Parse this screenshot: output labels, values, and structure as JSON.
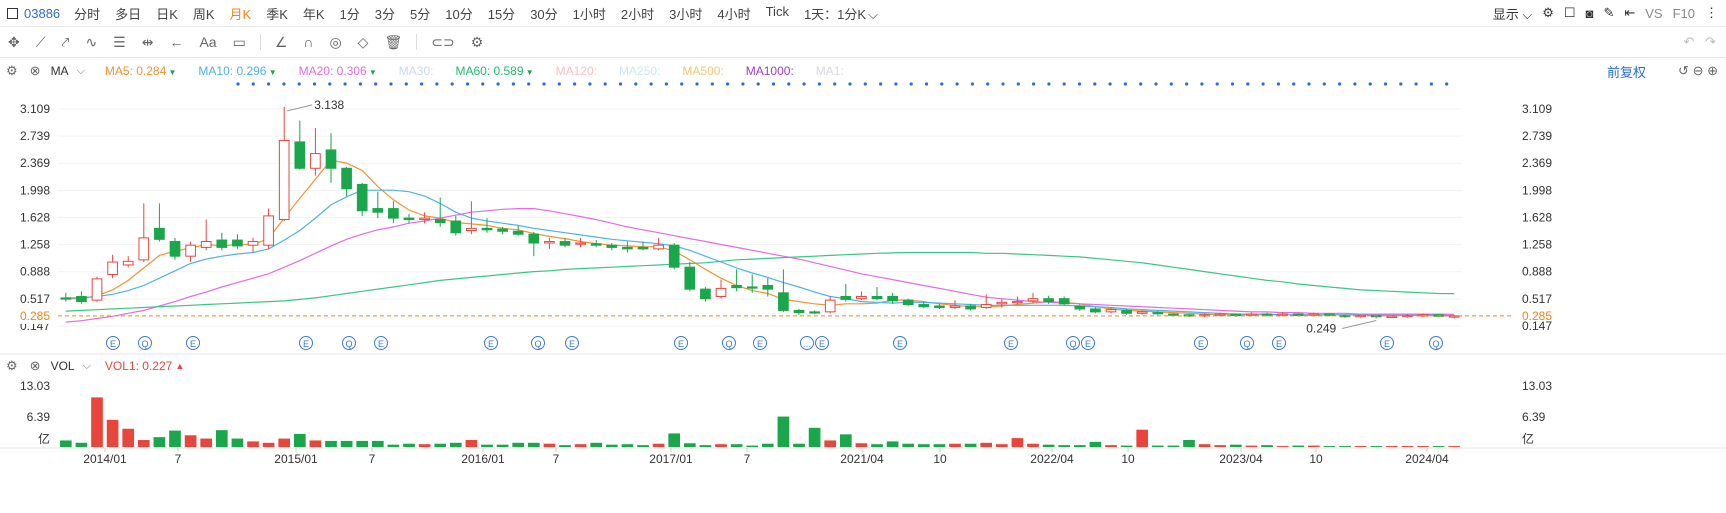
{
  "top": {
    "code": "03886",
    "periods": [
      "分时",
      "多日",
      "日K",
      "周K",
      "月K",
      "季K",
      "年K",
      "1分",
      "3分",
      "5分",
      "10分",
      "15分",
      "30分",
      "1小时",
      "2小时",
      "3小时",
      "4小时",
      "Tick"
    ],
    "active_period": "月K",
    "interval_select": "1天：1分K",
    "display": "显示",
    "vs_label": "VS",
    "f10_label": "F10"
  },
  "toolbar": {
    "text_tool": "Aa"
  },
  "indicator": {
    "name": "MA",
    "ma": [
      {
        "label": "MA5: 0.284",
        "color": "#f29335",
        "arrow": "down"
      },
      {
        "label": "MA10: 0.296",
        "color": "#4fb2e8",
        "arrow": "down"
      },
      {
        "label": "MA20: 0.306",
        "color": "#e26de0",
        "arrow": "down"
      },
      {
        "label": "MA30:",
        "color": "#c8daf0"
      },
      {
        "label": "MA60: 0.589",
        "color": "#26b774",
        "arrow": "down"
      },
      {
        "label": "MA120:",
        "color": "#f4c3c3"
      },
      {
        "label": "MA250:",
        "color": "#c9e8f3"
      },
      {
        "label": "MA500:",
        "color": "#f3c577"
      },
      {
        "label": "MA1000:",
        "color": "#9a41c9"
      },
      {
        "label": "MA1:",
        "color": "#d8d8e0"
      }
    ],
    "adjust": "前复权"
  },
  "vol_indicator": {
    "name": "VOL",
    "vol1": "VOL1: 0.227"
  },
  "colors": {
    "up": "#e8463d",
    "down": "#1aa64a",
    "accent": "#2b6cd6",
    "last_price": "#f0861a"
  },
  "chart_data": {
    "type": "candlestick",
    "price_ticks": [
      "3.109",
      "2.739",
      "2.369",
      "1.998",
      "1.628",
      "1.258",
      "0.888",
      "0.517",
      "0.147"
    ],
    "last_price": "0.285",
    "high_label": "3.138",
    "low_label": "0.249",
    "ylim": [
      0.147,
      3.138
    ],
    "x_ticks": [
      "2014/01",
      "7",
      "2015/01",
      "7",
      "2016/01",
      "7",
      "2017/01",
      "7",
      "2021/04",
      "10",
      "2022/04",
      "10",
      "2023/04",
      "10",
      "2024/04"
    ],
    "vol_ticks": [
      "13.03",
      "6.39",
      "亿"
    ],
    "candles": [
      [
        0.53,
        0.52,
        0.6,
        0.48
      ],
      [
        0.55,
        0.48,
        0.62,
        0.45
      ],
      [
        0.5,
        0.79,
        0.82,
        0.48
      ],
      [
        0.85,
        1.02,
        1.12,
        0.8
      ],
      [
        0.98,
        1.03,
        1.1,
        0.95
      ],
      [
        1.05,
        1.35,
        1.82,
        1.02
      ],
      [
        1.48,
        1.33,
        1.82,
        1.3
      ],
      [
        1.3,
        1.1,
        1.35,
        1.05
      ],
      [
        1.1,
        1.25,
        1.3,
        1.02
      ],
      [
        1.22,
        1.3,
        1.6,
        1.18
      ],
      [
        1.32,
        1.22,
        1.42,
        1.18
      ],
      [
        1.32,
        1.24,
        1.4,
        1.2
      ],
      [
        1.25,
        1.3,
        1.35,
        1.15
      ],
      [
        1.25,
        1.65,
        1.75,
        1.2
      ],
      [
        1.6,
        2.68,
        3.138,
        1.58
      ],
      [
        2.66,
        2.3,
        2.95,
        2.28
      ],
      [
        2.3,
        2.5,
        2.85,
        2.2
      ],
      [
        2.55,
        2.3,
        2.78,
        2.1
      ],
      [
        2.3,
        2.02,
        2.32,
        1.92
      ],
      [
        2.08,
        1.72,
        2.1,
        1.65
      ],
      [
        1.75,
        1.7,
        1.98,
        1.62
      ],
      [
        1.75,
        1.62,
        1.85,
        1.55
      ],
      [
        1.62,
        1.6,
        1.68,
        1.55
      ],
      [
        1.6,
        1.62,
        1.7,
        1.55
      ],
      [
        1.6,
        1.56,
        1.9,
        1.5
      ],
      [
        1.58,
        1.42,
        1.65,
        1.38
      ],
      [
        1.45,
        1.48,
        1.85,
        1.4
      ],
      [
        1.48,
        1.46,
        1.62,
        1.42
      ],
      [
        1.47,
        1.44,
        1.5,
        1.4
      ],
      [
        1.44,
        1.4,
        1.52,
        1.38
      ],
      [
        1.4,
        1.28,
        1.43,
        1.1
      ],
      [
        1.28,
        1.3,
        1.35,
        1.2
      ],
      [
        1.3,
        1.25,
        1.35,
        1.22
      ],
      [
        1.27,
        1.28,
        1.35,
        1.22
      ],
      [
        1.27,
        1.25,
        1.32,
        1.22
      ],
      [
        1.25,
        1.22,
        1.28,
        1.18
      ],
      [
        1.22,
        1.2,
        1.3,
        1.15
      ],
      [
        1.22,
        1.2,
        1.3,
        1.18
      ],
      [
        1.2,
        1.25,
        1.35,
        1.18
      ],
      [
        1.25,
        0.95,
        1.28,
        0.92
      ],
      [
        0.95,
        0.65,
        1.02,
        0.62
      ],
      [
        0.65,
        0.52,
        0.68,
        0.48
      ],
      [
        0.55,
        0.66,
        0.78,
        0.52
      ],
      [
        0.7,
        0.67,
        0.92,
        0.62
      ],
      [
        0.68,
        0.67,
        0.85,
        0.6
      ],
      [
        0.7,
        0.65,
        0.8,
        0.55
      ],
      [
        0.6,
        0.36,
        0.92,
        0.34
      ],
      [
        0.36,
        0.33,
        0.38,
        0.3
      ],
      [
        0.34,
        0.33,
        0.36,
        0.31
      ],
      [
        0.34,
        0.5,
        0.55,
        0.32
      ],
      [
        0.55,
        0.51,
        0.72,
        0.48
      ],
      [
        0.52,
        0.55,
        0.62,
        0.5
      ],
      [
        0.55,
        0.52,
        0.68,
        0.5
      ],
      [
        0.55,
        0.49,
        0.6,
        0.45
      ],
      [
        0.5,
        0.44,
        0.52,
        0.42
      ],
      [
        0.44,
        0.41,
        0.48,
        0.39
      ],
      [
        0.42,
        0.4,
        0.45,
        0.38
      ],
      [
        0.4,
        0.42,
        0.5,
        0.38
      ],
      [
        0.42,
        0.38,
        0.45,
        0.36
      ],
      [
        0.4,
        0.44,
        0.58,
        0.38
      ],
      [
        0.45,
        0.47,
        0.52,
        0.4
      ],
      [
        0.47,
        0.48,
        0.55,
        0.44
      ],
      [
        0.49,
        0.52,
        0.6,
        0.46
      ],
      [
        0.52,
        0.48,
        0.56,
        0.45
      ],
      [
        0.52,
        0.45,
        0.55,
        0.43
      ],
      [
        0.42,
        0.38,
        0.44,
        0.35
      ],
      [
        0.38,
        0.34,
        0.4,
        0.32
      ],
      [
        0.34,
        0.37,
        0.4,
        0.32
      ],
      [
        0.36,
        0.32,
        0.38,
        0.3
      ],
      [
        0.32,
        0.34,
        0.36,
        0.3
      ],
      [
        0.33,
        0.32,
        0.35,
        0.3
      ],
      [
        0.31,
        0.3,
        0.32,
        0.28
      ],
      [
        0.3,
        0.29,
        0.31,
        0.27
      ],
      [
        0.29,
        0.3,
        0.32,
        0.27
      ],
      [
        0.3,
        0.31,
        0.33,
        0.28
      ],
      [
        0.31,
        0.29,
        0.32,
        0.27
      ],
      [
        0.3,
        0.31,
        0.33,
        0.28
      ],
      [
        0.31,
        0.3,
        0.33,
        0.28
      ],
      [
        0.3,
        0.31,
        0.34,
        0.28
      ],
      [
        0.31,
        0.29,
        0.32,
        0.28
      ],
      [
        0.3,
        0.31,
        0.33,
        0.28
      ],
      [
        0.31,
        0.3,
        0.32,
        0.28
      ],
      [
        0.29,
        0.28,
        0.3,
        0.26
      ],
      [
        0.28,
        0.29,
        0.3,
        0.26
      ],
      [
        0.29,
        0.28,
        0.29,
        0.25
      ],
      [
        0.28,
        0.28,
        0.29,
        0.26
      ],
      [
        0.28,
        0.29,
        0.31,
        0.26
      ],
      [
        0.29,
        0.3,
        0.32,
        0.27
      ],
      [
        0.3,
        0.28,
        0.31,
        0.27
      ],
      [
        0.28,
        0.285,
        0.3,
        0.25
      ]
    ],
    "volumes": [
      1.4,
      0.9,
      10.6,
      5.8,
      3.9,
      1.5,
      2.1,
      3.5,
      2.5,
      1.8,
      3.6,
      1.8,
      1.2,
      0.9,
      1.8,
      2.8,
      1.4,
      1.3,
      1.3,
      1.3,
      1.3,
      0.5,
      0.7,
      0.6,
      0.7,
      0.9,
      1.5,
      0.5,
      0.5,
      0.9,
      0.9,
      0.7,
      0.4,
      0.6,
      0.9,
      0.5,
      0.6,
      0.4,
      0.7,
      2.9,
      0.8,
      0.4,
      0.6,
      0.6,
      0.3,
      0.7,
      6.5,
      0.7,
      4.1,
      1.4,
      2.7,
      0.8,
      0.6,
      1.2,
      0.7,
      0.6,
      0.6,
      0.7,
      0.7,
      0.9,
      0.6,
      1.9,
      0.7,
      0.5,
      0.4,
      0.4,
      1.1,
      0.4,
      0.3,
      3.7,
      0.3,
      0.3,
      1.5,
      0.6,
      0.4,
      0.5,
      0.3,
      0.4,
      0.2,
      0.3,
      0.3,
      0.2,
      0.2,
      0.2,
      0.2,
      0.2,
      0.2,
      0.2,
      0.2,
      0.2
    ],
    "ma_series": {
      "ma5": [
        0.52,
        0.52,
        0.56,
        0.64,
        0.77,
        0.94,
        1.11,
        1.17,
        1.21,
        1.26,
        1.24,
        1.26,
        1.26,
        1.34,
        1.62,
        1.89,
        2.15,
        2.41,
        2.37,
        2.27,
        2.05,
        1.87,
        1.73,
        1.65,
        1.62,
        1.56,
        1.54,
        1.52,
        1.48,
        1.46,
        1.41,
        1.37,
        1.34,
        1.3,
        1.27,
        1.25,
        1.24,
        1.23,
        1.23,
        1.17,
        1.05,
        0.92,
        0.8,
        0.7,
        0.63,
        0.59,
        0.51,
        0.48,
        0.45,
        0.43,
        0.45,
        0.45,
        0.46,
        0.5,
        0.5,
        0.48,
        0.45,
        0.43,
        0.41,
        0.41,
        0.42,
        0.44,
        0.46,
        0.48,
        0.47,
        0.45,
        0.41,
        0.38,
        0.36,
        0.35,
        0.34,
        0.33,
        0.32,
        0.31,
        0.3,
        0.3,
        0.3,
        0.3,
        0.3,
        0.3,
        0.3,
        0.3,
        0.3,
        0.3,
        0.29,
        0.29,
        0.29,
        0.29,
        0.29,
        0.284
      ],
      "ma10": [
        0.53,
        0.53,
        0.55,
        0.58,
        0.63,
        0.7,
        0.8,
        0.9,
        1.0,
        1.06,
        1.1,
        1.13,
        1.15,
        1.2,
        1.32,
        1.45,
        1.62,
        1.8,
        1.91,
        2.0,
        2.0,
        2.0,
        1.98,
        1.92,
        1.82,
        1.7,
        1.62,
        1.58,
        1.55,
        1.52,
        1.48,
        1.45,
        1.42,
        1.39,
        1.36,
        1.33,
        1.31,
        1.29,
        1.27,
        1.24,
        1.18,
        1.1,
        1.02,
        0.94,
        0.87,
        0.81,
        0.74,
        0.68,
        0.61,
        0.55,
        0.52,
        0.48,
        0.47,
        0.46,
        0.47,
        0.47,
        0.46,
        0.45,
        0.44,
        0.43,
        0.43,
        0.43,
        0.43,
        0.43,
        0.43,
        0.42,
        0.41,
        0.4,
        0.38,
        0.37,
        0.36,
        0.35,
        0.34,
        0.33,
        0.32,
        0.31,
        0.31,
        0.31,
        0.3,
        0.3,
        0.3,
        0.3,
        0.3,
        0.3,
        0.3,
        0.3,
        0.3,
        0.3,
        0.3,
        0.296
      ],
      "ma20": [
        0.2,
        0.22,
        0.25,
        0.28,
        0.32,
        0.36,
        0.42,
        0.48,
        0.55,
        0.61,
        0.68,
        0.74,
        0.8,
        0.86,
        0.95,
        1.04,
        1.14,
        1.24,
        1.33,
        1.4,
        1.46,
        1.5,
        1.55,
        1.58,
        1.62,
        1.66,
        1.7,
        1.72,
        1.74,
        1.75,
        1.75,
        1.72,
        1.68,
        1.64,
        1.6,
        1.55,
        1.5,
        1.46,
        1.42,
        1.38,
        1.34,
        1.3,
        1.26,
        1.22,
        1.18,
        1.14,
        1.1,
        1.06,
        1.01,
        0.96,
        0.91,
        0.86,
        0.82,
        0.78,
        0.74,
        0.7,
        0.66,
        0.62,
        0.58,
        0.54,
        0.52,
        0.5,
        0.48,
        0.47,
        0.46,
        0.45,
        0.44,
        0.43,
        0.42,
        0.41,
        0.4,
        0.39,
        0.38,
        0.37,
        0.36,
        0.35,
        0.34,
        0.34,
        0.33,
        0.33,
        0.32,
        0.32,
        0.32,
        0.31,
        0.31,
        0.31,
        0.31,
        0.31,
        0.31,
        0.306
      ],
      "ma60": [
        0.35,
        0.36,
        0.37,
        0.38,
        0.39,
        0.4,
        0.41,
        0.42,
        0.43,
        0.44,
        0.45,
        0.46,
        0.47,
        0.48,
        0.49,
        0.51,
        0.53,
        0.56,
        0.59,
        0.62,
        0.65,
        0.68,
        0.71,
        0.74,
        0.77,
        0.79,
        0.81,
        0.83,
        0.85,
        0.87,
        0.89,
        0.9,
        0.92,
        0.93,
        0.94,
        0.95,
        0.96,
        0.97,
        0.98,
        0.99,
        1.0,
        1.01,
        1.03,
        1.05,
        1.06,
        1.07,
        1.08,
        1.09,
        1.1,
        1.11,
        1.12,
        1.13,
        1.14,
        1.145,
        1.15,
        1.15,
        1.15,
        1.15,
        1.15,
        1.14,
        1.14,
        1.13,
        1.12,
        1.11,
        1.1,
        1.09,
        1.07,
        1.05,
        1.03,
        1.01,
        0.98,
        0.95,
        0.92,
        0.89,
        0.86,
        0.83,
        0.8,
        0.77,
        0.75,
        0.72,
        0.7,
        0.68,
        0.66,
        0.64,
        0.63,
        0.62,
        0.61,
        0.6,
        0.59,
        0.589
      ]
    }
  }
}
